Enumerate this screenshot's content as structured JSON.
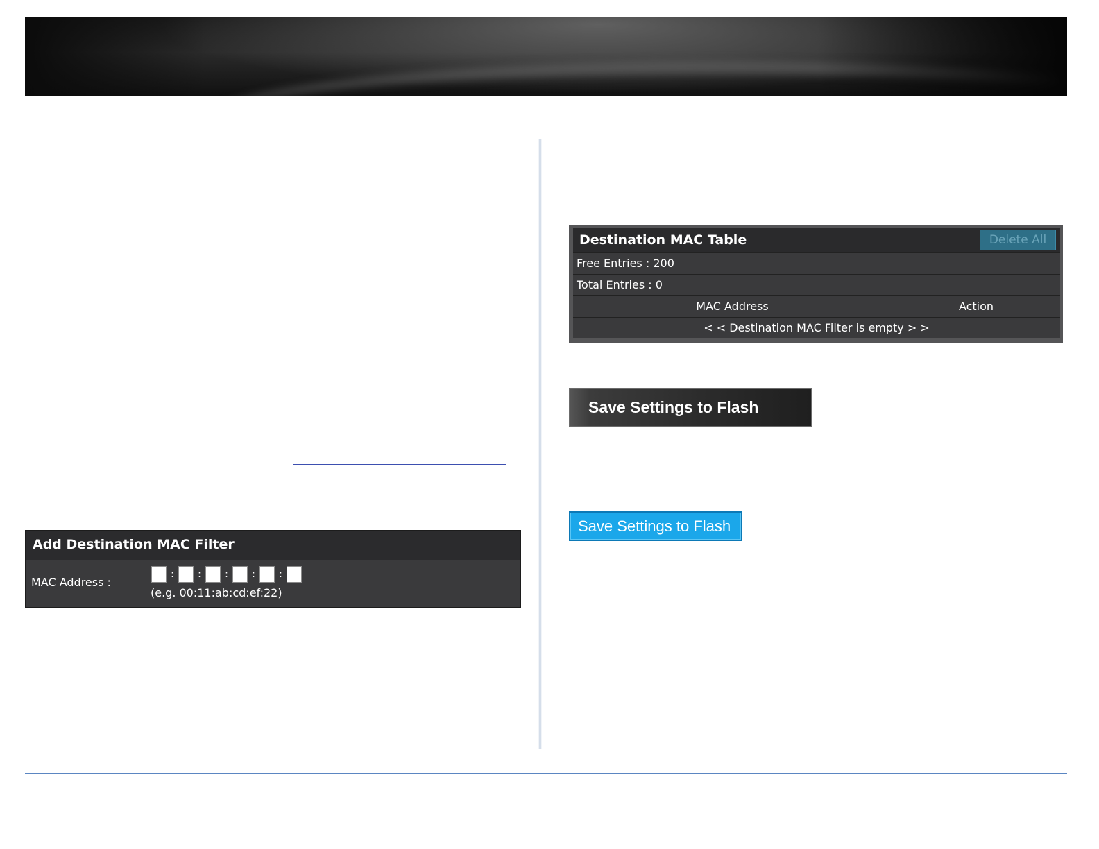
{
  "add_panel": {
    "title": "Add Destination MAC Filter",
    "mac_label": "MAC Address :",
    "separator": ":",
    "example": "(e.g. 00:11:ab:cd:ef:22)"
  },
  "mac_table": {
    "title": "Destination MAC Table",
    "delete_all_label": "Delete All",
    "free_entries": "Free Entries : 200",
    "total_entries": "Total Entries : 0",
    "col_mac": "MAC Address",
    "col_action": "Action",
    "empty_message": "< < Destination MAC Filter is empty > >"
  },
  "save_dark_label": "Save Settings to Flash",
  "save_blue_label": "Save Settings to Flash",
  "colors": {
    "accent_blue": "#1ba7ea",
    "panel_dark": "#3a3a3c",
    "footer_line": "#5b86c2"
  }
}
